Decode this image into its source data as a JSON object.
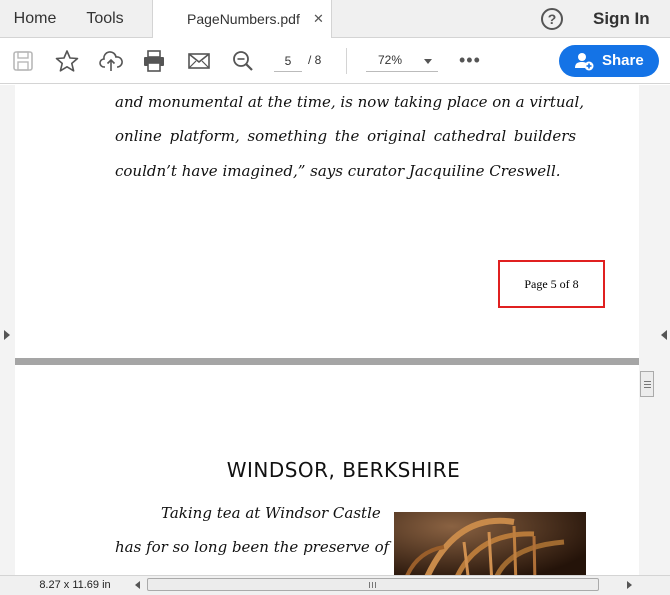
{
  "tabs": {
    "home_label": "Home",
    "tools_label": "Tools",
    "document_label": "PageNumbers.pdf",
    "close_label": "✕"
  },
  "header": {
    "help_icon": "help-circle-icon",
    "help_glyph": "?",
    "signin_label": "Sign In"
  },
  "toolbar": {
    "icons": [
      "save-icon",
      "bookmark-star-icon",
      "upload-cloud-icon",
      "print-icon",
      "mail-icon",
      "zoom-search-icon"
    ],
    "current_page": "5",
    "total_pages": "/ 8",
    "zoom": "72%",
    "more_label": "•••",
    "share_label": "Share",
    "share_color": "#1473e6"
  },
  "document": {
    "page1": {
      "lines": [
        "and monumental at the time, is now taking place on a virtual,",
        "online platform, something the original cathedral builders",
        "couldn’t have imagined,” says curator Jacquiline Creswell."
      ],
      "page_number_label": "Page 5 of 8",
      "highlight_color": "#e02020"
    },
    "page2": {
      "heading": "WINDSOR, BERKSHIRE",
      "lines": [
        "Taking tea at Windsor Castle",
        "has for so long been the preserve of"
      ]
    }
  },
  "statusbar": {
    "page_size": "8.27 x 11.69 in"
  }
}
